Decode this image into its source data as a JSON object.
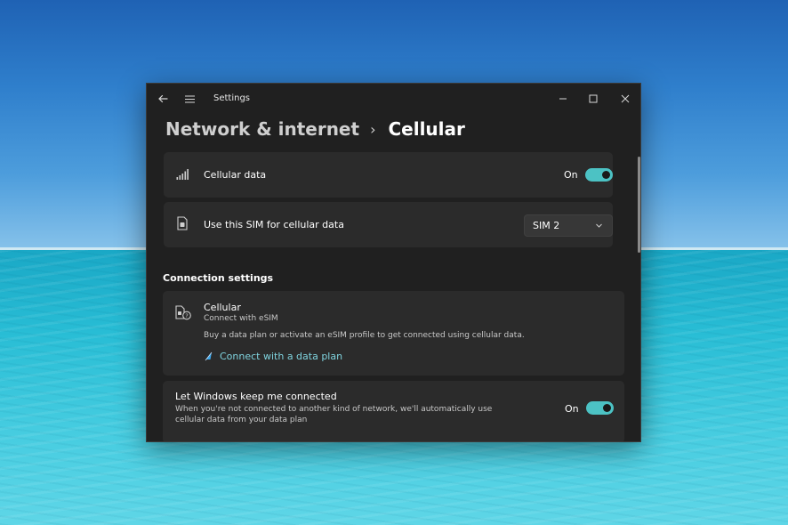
{
  "window": {
    "app_title": "Settings"
  },
  "breadcrumb": {
    "parent": "Network & internet",
    "separator": "›",
    "current": "Cellular"
  },
  "cellular_data": {
    "label": "Cellular data",
    "state_label": "On",
    "enabled": true,
    "icon": "signal-bars-icon"
  },
  "sim_select": {
    "label": "Use this SIM for cellular data",
    "selected": "SIM 2",
    "icon": "sim-card-icon"
  },
  "connection_settings": {
    "heading": "Connection settings",
    "cellular": {
      "title": "Cellular",
      "subtitle": "Connect with eSIM",
      "description": "Buy a data plan or activate an eSIM profile to get connected using cellular data.",
      "link": "Connect with a data plan",
      "icon": "esim-help-icon"
    },
    "keep_connected": {
      "title": "Let Windows keep me connected",
      "description_line1": "When you're not connected to another kind of network, we'll automatically use",
      "description_line2": "cellular data from your data plan",
      "state_label": "On",
      "enabled": true
    }
  },
  "colors": {
    "accent": "#4cc2c4",
    "link": "#7fd3de",
    "window_bg": "#202020",
    "card_bg": "#2b2b2b"
  }
}
